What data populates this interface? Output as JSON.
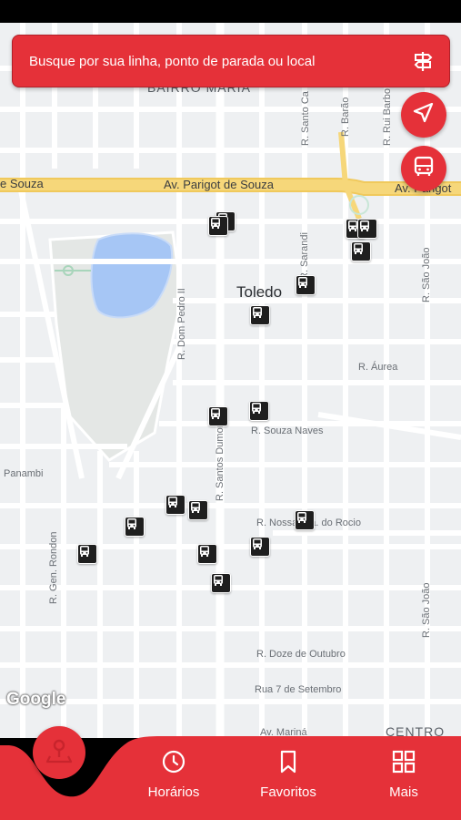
{
  "search": {
    "placeholder": "Busque por sua linha, ponto de parada ou local",
    "directions_icon": "signpost-icon"
  },
  "fabs": {
    "locate_icon": "navigation-arrow-icon",
    "bus_icon": "bus-icon"
  },
  "map": {
    "provider_logo": "Google",
    "neighborhood": "Toledo",
    "labels": {
      "district_top": "BAIRRO MARIA",
      "district_bottom": "CENTRO",
      "av_parigot_left": "e Souza",
      "av_parigot_center": "Av. Parigot de Souza",
      "av_parigot_right": "Av. Parigot",
      "av_marina": "Av. Mariná",
      "r_santo_ca": "R. Santo Ca",
      "r_barao": "R. Barão",
      "r_rui_barbo": "R. Rui Barbo",
      "r_sao_joao_top": "R. São João",
      "r_sao_joao_bottom": "R. São João",
      "r_sarandi": "R. Sarandi",
      "r_dom_pedro": "R. Dom Pedro II",
      "r_aurea": "R. Áurea",
      "r_santos_dumont": "R. Santos Dumont",
      "r_souza_naves": "R. Souza Naves",
      "panambi": "Panambi",
      "r_nossa_sra": "R. Nossa Sra. do Rocio",
      "r_gen_rondon": "R. Gen. Rondon",
      "r_doze": "R. Doze de Outubro",
      "rua_7": "Rua 7 de Setembro"
    },
    "bus_stop_icon": "bus-stop-icon"
  },
  "bottom_nav": {
    "map_icon": "map-pin-icon",
    "items": [
      {
        "label": "Horários",
        "icon": "clock-icon"
      },
      {
        "label": "Favoritos",
        "icon": "bookmark-icon"
      },
      {
        "label": "Mais",
        "icon": "grid-icon"
      }
    ]
  },
  "colors": {
    "accent": "#e53139",
    "road_major": "#f6d77a",
    "water": "#a6c6f5",
    "park": "#e2e6e3",
    "map_bg": "#eef0f2"
  }
}
